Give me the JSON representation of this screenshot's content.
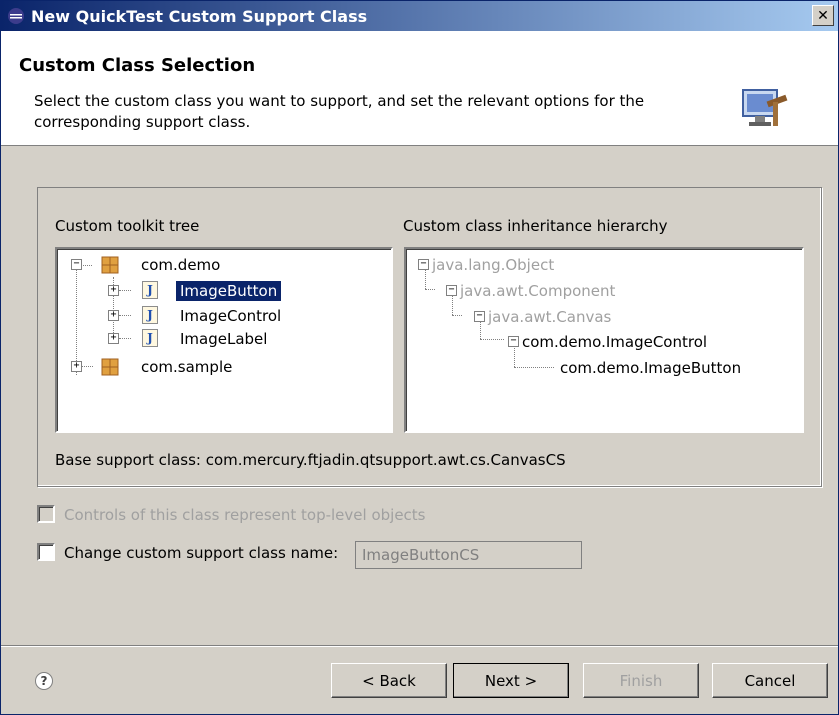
{
  "window": {
    "title": "New QuickTest Custom Support Class",
    "close_label": "✕"
  },
  "header": {
    "title": "Custom Class Selection",
    "description": "Select the custom class you want to support, and set the relevant options for the corresponding support class."
  },
  "toolkit_tree": {
    "label": "Custom toolkit tree",
    "items": [
      {
        "label": "com.demo",
        "type": "package",
        "expanded": true
      },
      {
        "label": "ImageButton",
        "type": "class",
        "selected": true
      },
      {
        "label": "ImageControl",
        "type": "class"
      },
      {
        "label": "ImageLabel",
        "type": "class"
      },
      {
        "label": "com.sample",
        "type": "package",
        "expanded": false
      }
    ]
  },
  "hierarchy_tree": {
    "label": "Custom class inheritance hierarchy",
    "items": [
      {
        "label": "java.lang.Object",
        "disabled": true
      },
      {
        "label": "java.awt.Component",
        "disabled": true
      },
      {
        "label": "java.awt.Canvas",
        "disabled": true
      },
      {
        "label": "com.demo.ImageControl",
        "disabled": false
      },
      {
        "label": "com.demo.ImageButton",
        "disabled": false
      }
    ]
  },
  "base_support_class": "Base support class: com.mercury.ftjadin.qtsupport.awt.cs.CanvasCS",
  "options": {
    "top_level_label": "Controls of this class represent top-level objects",
    "top_level_checked": false,
    "change_name_label": "Change custom support class name:",
    "change_name_checked": false,
    "class_name_value": "ImageButtonCS"
  },
  "buttons": {
    "back": "< Back",
    "next": "Next >",
    "finish": "Finish",
    "cancel": "Cancel",
    "help": "?"
  },
  "colors": {
    "title_bar": "#0a246a",
    "selection": "#0a246a",
    "dialog_bg": "#d4d0c8",
    "disabled_text": "#a0a0a0"
  }
}
